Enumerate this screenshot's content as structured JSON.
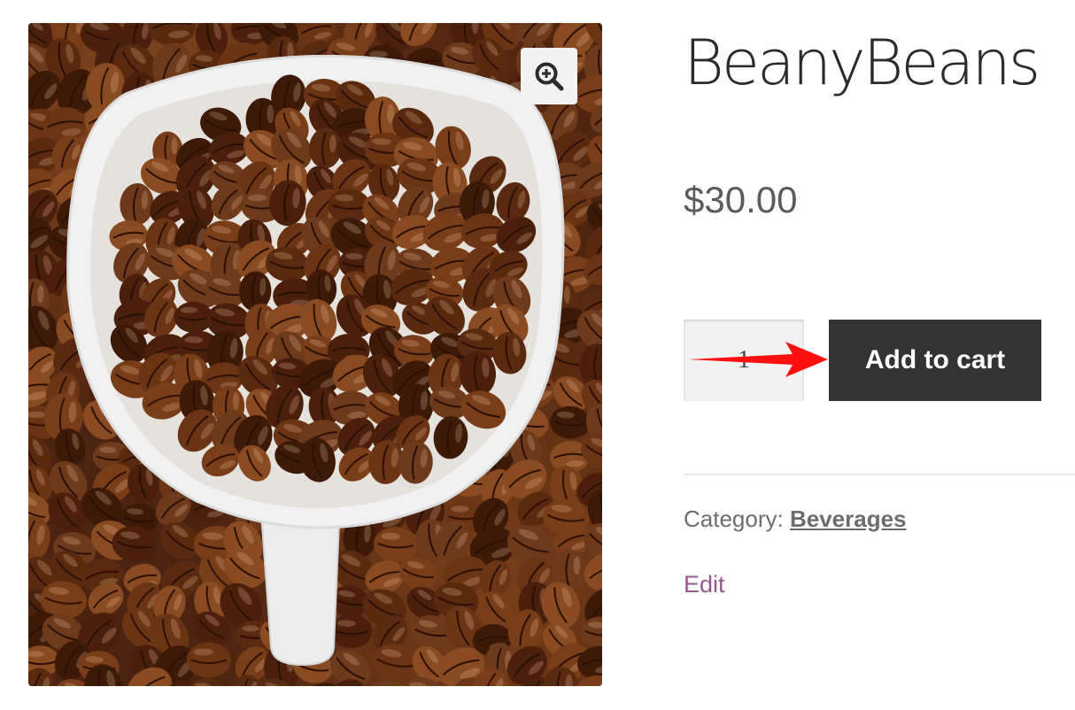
{
  "gallery": {
    "image_alt": "Coffee beans in white scoop",
    "zoom_icon": "magnifier-plus-icon"
  },
  "product": {
    "title": "BeanyBeans",
    "price": "$30.00",
    "quantity": "1",
    "add_to_cart_label": "Add to cart",
    "category_label": "Category:",
    "category_name": "Beverages",
    "edit_label": "Edit"
  },
  "annotation": {
    "arrow_color": "#ff1010"
  },
  "colors": {
    "button_bg": "#333333",
    "edit_link": "#96588a",
    "price": "#5b5b5b"
  }
}
